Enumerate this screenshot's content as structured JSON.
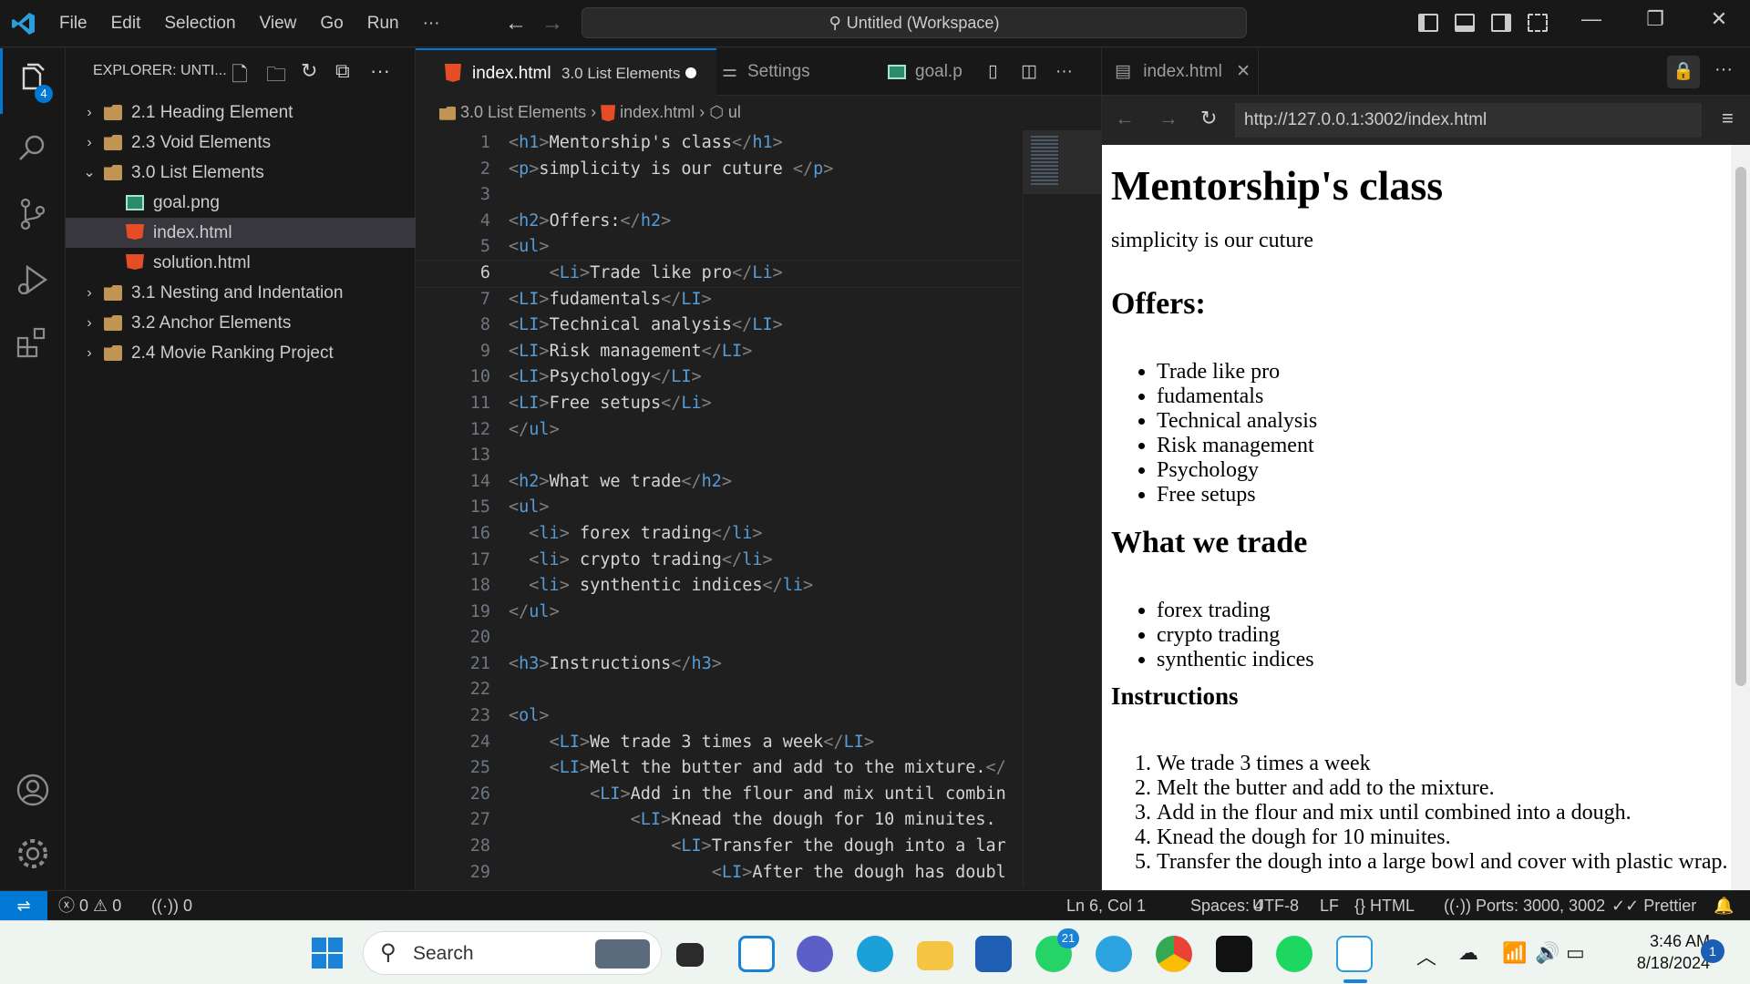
{
  "menu": [
    "File",
    "Edit",
    "Selection",
    "View",
    "Go",
    "Run",
    "···"
  ],
  "command_center": "Untitled (Workspace)",
  "explorer": {
    "title": "EXPLORER: UNTI...",
    "badge": "4",
    "tree": [
      {
        "label": "2.1 Heading Element",
        "type": "folder",
        "expanded": false,
        "depth": 0
      },
      {
        "label": "2.3 Void Elements",
        "type": "folder",
        "expanded": false,
        "depth": 0
      },
      {
        "label": "3.0 List Elements",
        "type": "folder",
        "expanded": true,
        "depth": 0
      },
      {
        "label": "goal.png",
        "type": "image",
        "depth": 1
      },
      {
        "label": "index.html",
        "type": "html",
        "depth": 1,
        "selected": true
      },
      {
        "label": "solution.html",
        "type": "html",
        "depth": 1
      },
      {
        "label": "3.1 Nesting and Indentation",
        "type": "folder",
        "expanded": false,
        "depth": 0
      },
      {
        "label": "3.2 Anchor Elements",
        "type": "folder",
        "expanded": false,
        "depth": 0
      },
      {
        "label": "2.4 Movie Ranking Project",
        "type": "folder",
        "expanded": false,
        "depth": 0
      }
    ]
  },
  "editor": {
    "tabs": [
      {
        "label": "index.html",
        "desc": "3.0 List Elements",
        "modified": true
      },
      {
        "label": "Settings"
      },
      {
        "label": "goal.p"
      }
    ],
    "breadcrumbs": [
      "3.0 List Elements",
      "index.html",
      "ul"
    ],
    "current_line": 6,
    "lines": [
      [
        [
          "tg",
          "<"
        ],
        [
          "tn",
          "h1"
        ],
        [
          "tg",
          ">"
        ],
        [
          "tx",
          "Mentorship's class"
        ],
        [
          "tg",
          "</"
        ],
        [
          "tn",
          "h1"
        ],
        [
          "tg",
          ">"
        ]
      ],
      [
        [
          "tg",
          "<"
        ],
        [
          "tn",
          "p"
        ],
        [
          "tg",
          ">"
        ],
        [
          "tx",
          "simplicity is our cuture "
        ],
        [
          "tg",
          "</"
        ],
        [
          "tn",
          "p"
        ],
        [
          "tg",
          ">"
        ]
      ],
      [],
      [
        [
          "tg",
          "<"
        ],
        [
          "tn",
          "h2"
        ],
        [
          "tg",
          ">"
        ],
        [
          "tx",
          "Offers:"
        ],
        [
          "tg",
          "</"
        ],
        [
          "tn",
          "h2"
        ],
        [
          "tg",
          ">"
        ]
      ],
      [
        [
          "tg",
          "<"
        ],
        [
          "tn",
          "ul"
        ],
        [
          "tg",
          ">"
        ]
      ],
      [
        [
          "tx",
          "    "
        ],
        [
          "tg",
          "<"
        ],
        [
          "tn",
          "Li"
        ],
        [
          "tg",
          ">"
        ],
        [
          "tx",
          "Trade like pro"
        ],
        [
          "tg",
          "</"
        ],
        [
          "tn",
          "Li"
        ],
        [
          "tg",
          ">"
        ]
      ],
      [
        [
          "tg",
          "<"
        ],
        [
          "tn",
          "LI"
        ],
        [
          "tg",
          ">"
        ],
        [
          "tx",
          "fudamentals"
        ],
        [
          "tg",
          "</"
        ],
        [
          "tn",
          "LI"
        ],
        [
          "tg",
          ">"
        ]
      ],
      [
        [
          "tg",
          "<"
        ],
        [
          "tn",
          "LI"
        ],
        [
          "tg",
          ">"
        ],
        [
          "tx",
          "Technical analysis"
        ],
        [
          "tg",
          "</"
        ],
        [
          "tn",
          "LI"
        ],
        [
          "tg",
          ">"
        ]
      ],
      [
        [
          "tg",
          "<"
        ],
        [
          "tn",
          "LI"
        ],
        [
          "tg",
          ">"
        ],
        [
          "tx",
          "Risk management"
        ],
        [
          "tg",
          "</"
        ],
        [
          "tn",
          "LI"
        ],
        [
          "tg",
          ">"
        ]
      ],
      [
        [
          "tg",
          "<"
        ],
        [
          "tn",
          "LI"
        ],
        [
          "tg",
          ">"
        ],
        [
          "tx",
          "Psychology"
        ],
        [
          "tg",
          "</"
        ],
        [
          "tn",
          "LI"
        ],
        [
          "tg",
          ">"
        ]
      ],
      [
        [
          "tg",
          "<"
        ],
        [
          "tn",
          "LI"
        ],
        [
          "tg",
          ">"
        ],
        [
          "tx",
          "Free setups"
        ],
        [
          "tg",
          "</"
        ],
        [
          "tn",
          "Li"
        ],
        [
          "tg",
          ">"
        ]
      ],
      [
        [
          "tg",
          "</"
        ],
        [
          "tn",
          "ul"
        ],
        [
          "tg",
          ">"
        ]
      ],
      [],
      [
        [
          "tg",
          "<"
        ],
        [
          "tn",
          "h2"
        ],
        [
          "tg",
          ">"
        ],
        [
          "tx",
          "What we trade"
        ],
        [
          "tg",
          "</"
        ],
        [
          "tn",
          "h2"
        ],
        [
          "tg",
          ">"
        ]
      ],
      [
        [
          "tg",
          "<"
        ],
        [
          "tn",
          "ul"
        ],
        [
          "tg",
          ">"
        ]
      ],
      [
        [
          "tx",
          "  "
        ],
        [
          "tg",
          "<"
        ],
        [
          "tn",
          "li"
        ],
        [
          "tg",
          ">"
        ],
        [
          "tx",
          " forex trading"
        ],
        [
          "tg",
          "</"
        ],
        [
          "tn",
          "li"
        ],
        [
          "tg",
          ">"
        ]
      ],
      [
        [
          "tx",
          "  "
        ],
        [
          "tg",
          "<"
        ],
        [
          "tn",
          "li"
        ],
        [
          "tg",
          ">"
        ],
        [
          "tx",
          " crypto trading"
        ],
        [
          "tg",
          "</"
        ],
        [
          "tn",
          "li"
        ],
        [
          "tg",
          ">"
        ]
      ],
      [
        [
          "tx",
          "  "
        ],
        [
          "tg",
          "<"
        ],
        [
          "tn",
          "li"
        ],
        [
          "tg",
          ">"
        ],
        [
          "tx",
          " synthentic indices"
        ],
        [
          "tg",
          "</"
        ],
        [
          "tn",
          "li"
        ],
        [
          "tg",
          ">"
        ]
      ],
      [
        [
          "tg",
          "</"
        ],
        [
          "tn",
          "ul"
        ],
        [
          "tg",
          ">"
        ]
      ],
      [],
      [
        [
          "tg",
          "<"
        ],
        [
          "tn",
          "h3"
        ],
        [
          "tg",
          ">"
        ],
        [
          "tx",
          "Instructions"
        ],
        [
          "tg",
          "</"
        ],
        [
          "tn",
          "h3"
        ],
        [
          "tg",
          ">"
        ]
      ],
      [],
      [
        [
          "tg",
          "<"
        ],
        [
          "tn",
          "ol"
        ],
        [
          "tg",
          ">"
        ]
      ],
      [
        [
          "tx",
          "    "
        ],
        [
          "tg",
          "<"
        ],
        [
          "tn",
          "LI"
        ],
        [
          "tg",
          ">"
        ],
        [
          "tx",
          "We trade 3 times a week"
        ],
        [
          "tg",
          "</"
        ],
        [
          "tn",
          "LI"
        ],
        [
          "tg",
          ">"
        ]
      ],
      [
        [
          "tx",
          "    "
        ],
        [
          "tg",
          "<"
        ],
        [
          "tn",
          "LI"
        ],
        [
          "tg",
          ">"
        ],
        [
          "tx",
          "Melt the butter and add to the mixture."
        ],
        [
          "tg",
          "</"
        ]
      ],
      [
        [
          "tx",
          "        "
        ],
        [
          "tg",
          "<"
        ],
        [
          "tn",
          "LI"
        ],
        [
          "tg",
          ">"
        ],
        [
          "tx",
          "Add in the flour and mix until combin"
        ]
      ],
      [
        [
          "tx",
          "            "
        ],
        [
          "tg",
          "<"
        ],
        [
          "tn",
          "LI"
        ],
        [
          "tg",
          ">"
        ],
        [
          "tx",
          "Knead the dough for 10 minuites."
        ]
      ],
      [
        [
          "tx",
          "                "
        ],
        [
          "tg",
          "<"
        ],
        [
          "tn",
          "LI"
        ],
        [
          "tg",
          ">"
        ],
        [
          "tx",
          "Transfer the dough into a lar"
        ]
      ],
      [
        [
          "tx",
          "                    "
        ],
        [
          "tg",
          "<"
        ],
        [
          "tn",
          "LI"
        ],
        [
          "tg",
          ">"
        ],
        [
          "tx",
          "After the dough has doubl"
        ]
      ]
    ]
  },
  "browser": {
    "tab": "index.html",
    "url": "http://127.0.0.1:3002/index.html",
    "page": {
      "h1": "Mentorship's class",
      "p": "simplicity is our cuture",
      "offers_heading": "Offers:",
      "offers": [
        "Trade like pro",
        "fudamentals",
        "Technical analysis",
        "Risk management",
        "Psychology",
        "Free setups"
      ],
      "trade_heading": "What we trade",
      "trade": [
        "forex trading",
        "crypto trading",
        "synthentic indices"
      ],
      "instructions_heading": "Instructions",
      "instructions": [
        "We trade 3 times a week",
        "Melt the butter and add to the mixture.",
        "Add in the flour and mix until combined into a dough.",
        "Knead the dough for 10 minuites.",
        "Transfer the dough into a large bowl and cover with plastic wrap."
      ]
    }
  },
  "statusbar": {
    "errors": "0",
    "warnings": "0",
    "ports_count": "0",
    "position": "Ln 6, Col 1",
    "spaces": "Spaces: 4",
    "encoding": "UTF-8",
    "eol": "LF",
    "language": "HTML",
    "ports": "Ports: 3000, 3002",
    "formatter": "Prettier"
  },
  "taskbar": {
    "search": "Search",
    "whatsapp_badge": "21",
    "time": "3:46 AM",
    "date": "8/18/2024",
    "notifications": "1"
  },
  "colors": {
    "accent": "#0078d4",
    "html_icon": "#e44d26",
    "folder_icon": "#c09553",
    "tag_name": "#569cd6"
  }
}
